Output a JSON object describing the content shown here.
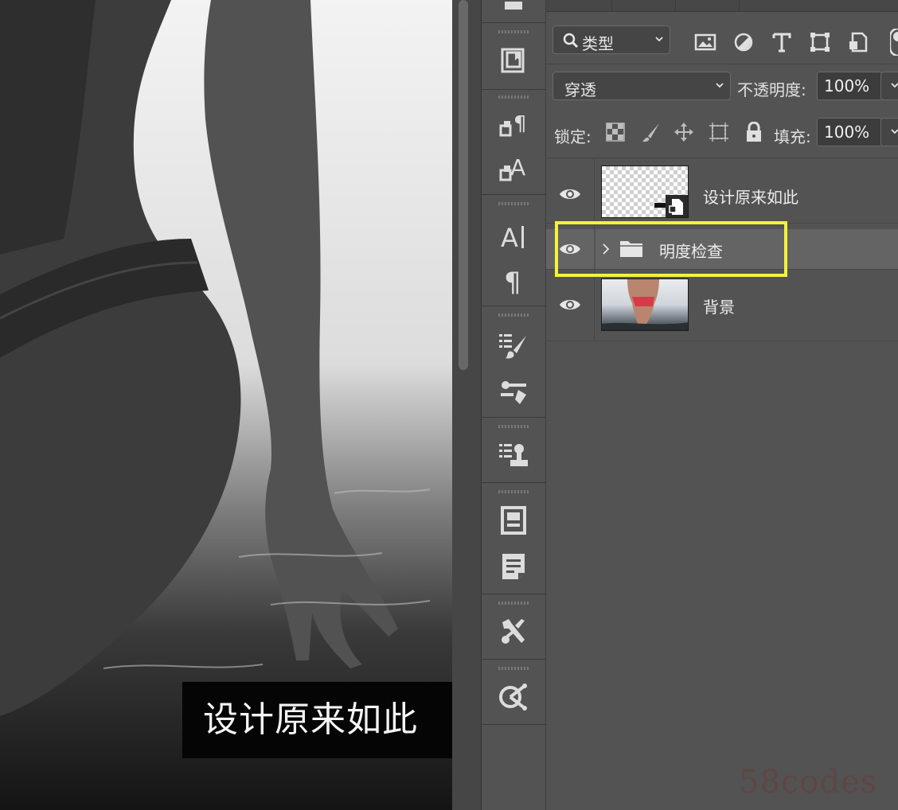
{
  "canvas": {
    "caption": "设计原来如此"
  },
  "layers_panel": {
    "filter": {
      "kind_label": "类型",
      "icons": [
        "image-filter-icon",
        "adjustment-filter-icon",
        "type-filter-icon",
        "shape-filter-icon",
        "smart-object-filter-icon"
      ]
    },
    "blend_mode": "穿透",
    "opacity_label": "不透明度:",
    "opacity_value": "100%",
    "lock_label": "锁定:",
    "fill_label": "填充:",
    "fill_value": "100%",
    "layers": [
      {
        "name": "设计原来如此",
        "type": "smart-object",
        "visible": true
      },
      {
        "name": "明度检查",
        "type": "group",
        "visible": true,
        "selected": true
      },
      {
        "name": "背景",
        "type": "image",
        "visible": true
      }
    ]
  },
  "watermark": "58codes",
  "colors": {
    "panel_bg": "#535353",
    "highlight": "#f4f23a",
    "selected_row": "#646464"
  }
}
